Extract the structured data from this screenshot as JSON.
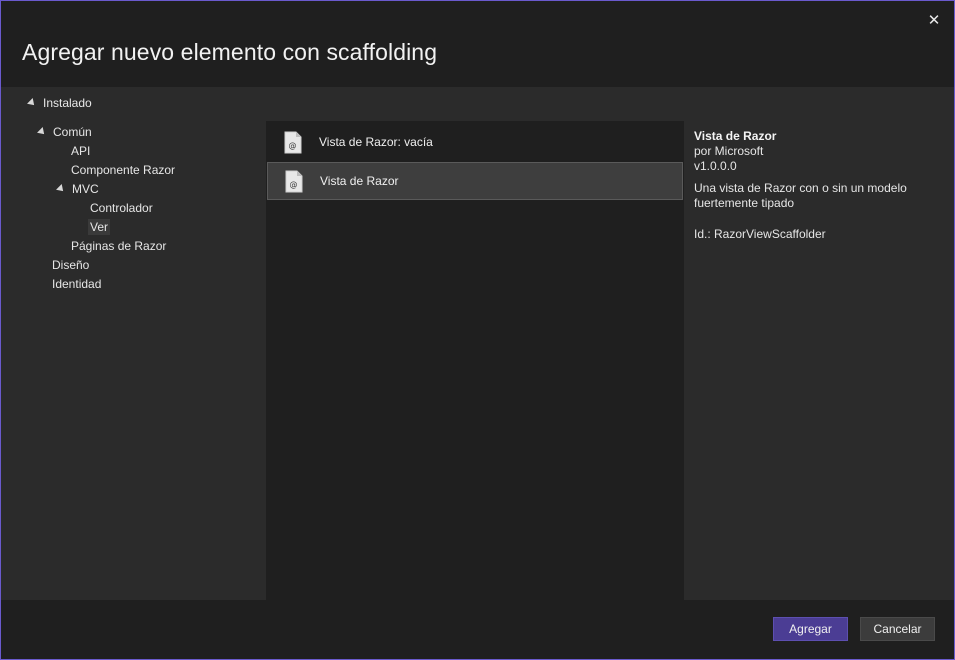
{
  "dialog": {
    "title": "Agregar nuevo elemento con scaffolding",
    "close_icon": "close-icon",
    "accent_color": "#4b3d94"
  },
  "tree": {
    "root_label": "Instalado",
    "nodes": [
      {
        "label": "Común",
        "expanded": true
      },
      {
        "label": "API"
      },
      {
        "label": "Componente Razor"
      },
      {
        "label": "MVC",
        "expanded": true
      },
      {
        "label": "Controlador"
      },
      {
        "label": "Ver",
        "selected": true
      },
      {
        "label": "Páginas de Razor"
      },
      {
        "label": "Diseño"
      },
      {
        "label": "Identidad"
      }
    ]
  },
  "templates": [
    {
      "label": "Vista de Razor: vacía",
      "icon": "razor-file-icon"
    },
    {
      "label": "Vista de Razor",
      "icon": "razor-file-icon",
      "selected": true
    }
  ],
  "details": {
    "name": "Vista de Razor",
    "author": "por Microsoft",
    "version": "v1.0.0.0",
    "description": "Una vista de Razor con o sin un modelo fuertemente tipado",
    "id": "Id.: RazorViewScaffolder"
  },
  "buttons": {
    "primary": "Agregar",
    "secondary": "Cancelar"
  }
}
